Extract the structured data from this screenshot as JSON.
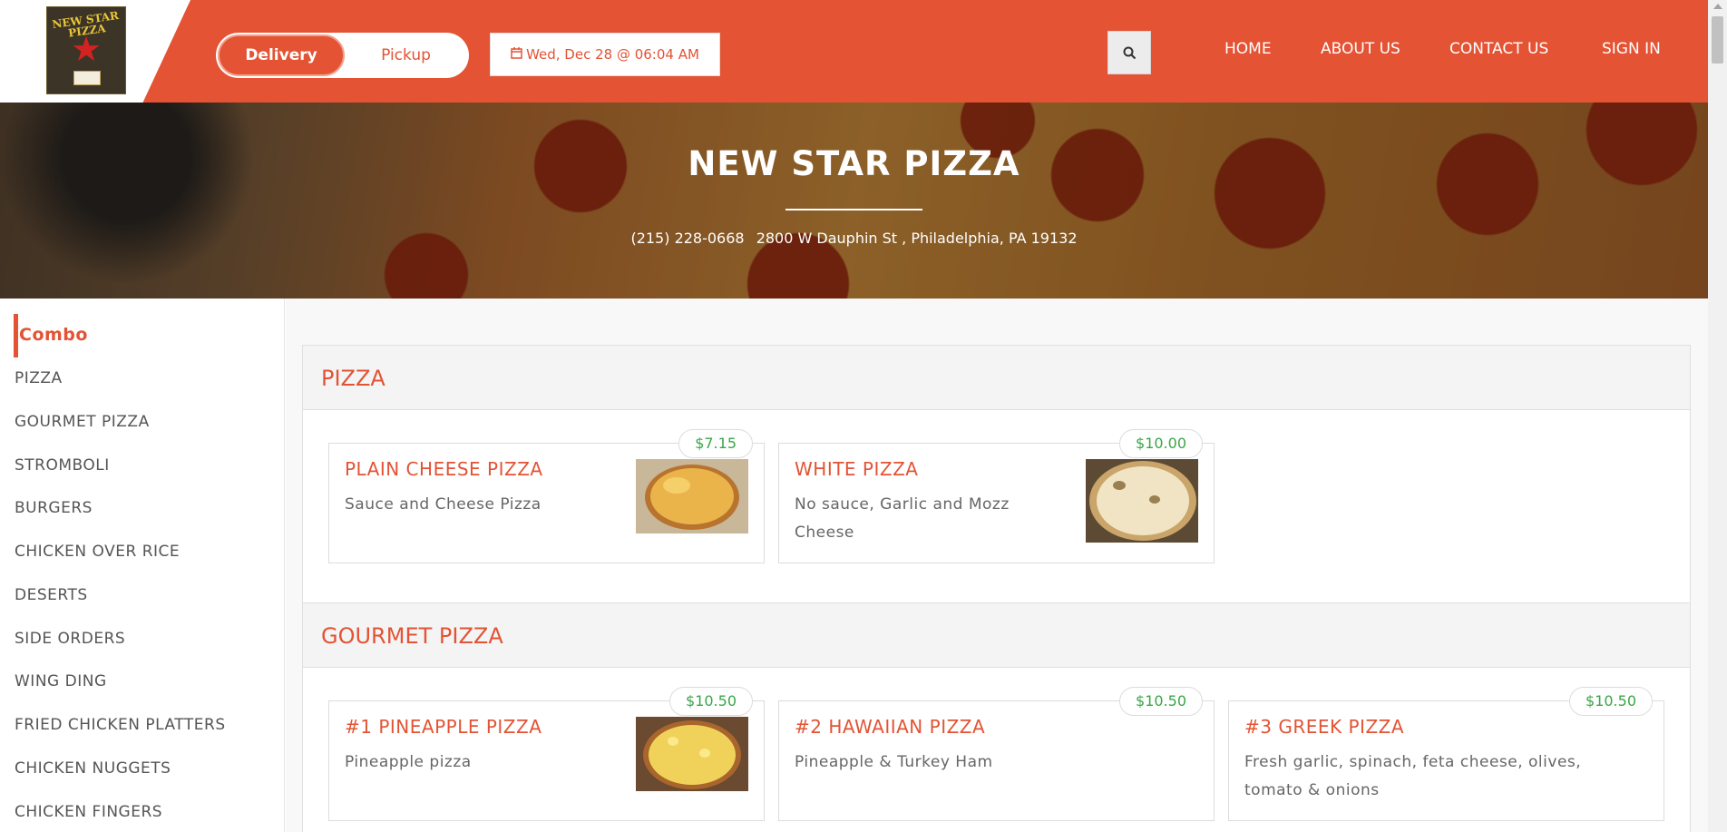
{
  "header": {
    "logo_text": "NEW STAR PIZZA",
    "delivery_label": "Delivery",
    "pickup_label": "Pickup",
    "date_label": "Wed, Dec 28 @ 06:04 AM",
    "nav": [
      "HOME",
      "ABOUT US",
      "CONTACT US",
      "SIGN IN"
    ]
  },
  "hero": {
    "title": "NEW STAR PIZZA",
    "phone": "(215) 228-0668",
    "address": "2800 W Dauphin St , Philadelphia, PA 19132"
  },
  "sidebar": {
    "items": [
      "Combo",
      "PIZZA",
      "GOURMET PIZZA",
      "STROMBOLI",
      "BURGERS",
      "CHICKEN OVER RICE",
      "DESERTS",
      "SIDE ORDERS",
      "WING DING",
      "FRIED CHICKEN PLATTERS",
      "CHICKEN NUGGETS",
      "CHICKEN FINGERS"
    ]
  },
  "sections": [
    {
      "title": "PIZZA",
      "items": [
        {
          "name": "PLAIN CHEESE PIZZA",
          "desc": "Sauce and Cheese Pizza",
          "price": "$7.15"
        },
        {
          "name": "WHITE PIZZA",
          "desc": "No sauce, Garlic and Mozz Cheese",
          "price": "$10.00"
        }
      ]
    },
    {
      "title": "GOURMET PIZZA",
      "items": [
        {
          "name": "#1 PINEAPPLE PIZZA",
          "desc": "Pineapple pizza",
          "price": "$10.50"
        },
        {
          "name": "#2 HAWAIIAN PIZZA",
          "desc": "Pineapple & Turkey Ham",
          "price": "$10.50"
        },
        {
          "name": "#3 GREEK PIZZA",
          "desc": "Fresh garlic, spinach, feta cheese, olives, tomato & onions",
          "price": "$10.50"
        }
      ]
    }
  ],
  "colors": {
    "brand": "#e35334",
    "price_green": "#3aa648"
  }
}
